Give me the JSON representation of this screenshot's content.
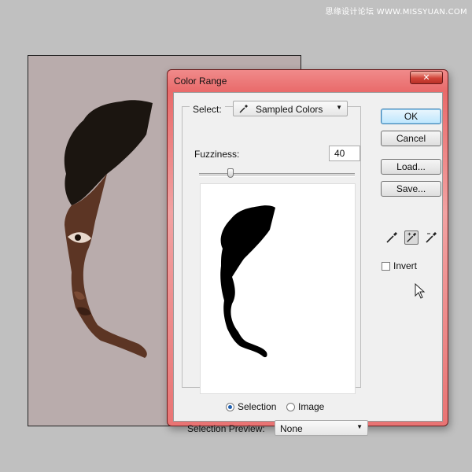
{
  "watermark": "思缘设计论坛 WWW.MISSYUAN.COM",
  "dialog": {
    "title": "Color Range",
    "close_icon": "close-icon"
  },
  "select": {
    "label": "Select:",
    "value": "Sampled Colors",
    "icon": "eyedropper-icon"
  },
  "fuzziness": {
    "label": "Fuzziness:",
    "value": "40",
    "slider_fraction": 0.2
  },
  "view_mode": {
    "selection_label": "Selection",
    "image_label": "Image",
    "selected": "Selection"
  },
  "selection_preview": {
    "label": "Selection Preview:",
    "value": "None"
  },
  "buttons": {
    "ok": "OK",
    "cancel": "Cancel",
    "load": "Load...",
    "save": "Save..."
  },
  "eyedroppers": [
    "eyedropper-icon",
    "eyedropper-plus-icon",
    "eyedropper-minus-icon"
  ],
  "invert": {
    "label": "Invert",
    "checked": false
  },
  "colors": {
    "title_bar": "#e96b6b",
    "canvas_bg": "#b9acac",
    "ok_button": "#bde6fd"
  }
}
